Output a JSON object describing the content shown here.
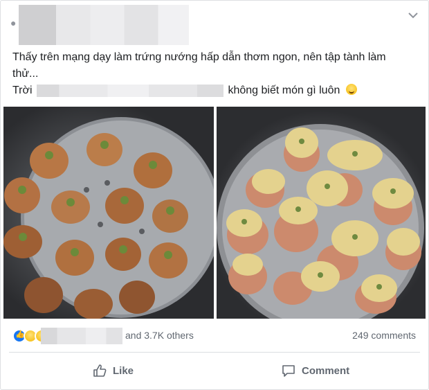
{
  "post": {
    "text_line1": "Thấy trên mạng dạy làm trứng nướng hấp dẫn thơm ngon, nên tập tành làm",
    "text_line2": "thử...",
    "text_line3_prefix": "Trời",
    "text_line3_suffix": "không biết món gì luôn"
  },
  "photos": [
    {
      "alt": "eggs-before-baking"
    },
    {
      "alt": "eggs-after-baking"
    }
  ],
  "reactions": {
    "types": [
      "like",
      "haha",
      "sad"
    ],
    "others_text": "and 3.7K others",
    "comments_text": "249 comments"
  },
  "actions": {
    "like_label": "Like",
    "comment_label": "Comment"
  },
  "icons": {
    "more": "chevron-down-icon",
    "like": "thumbs-up-icon",
    "comment": "comment-bubble-icon"
  },
  "colors": {
    "accent": "#1877f2",
    "text": "#1c1e21",
    "muted": "#606770"
  }
}
